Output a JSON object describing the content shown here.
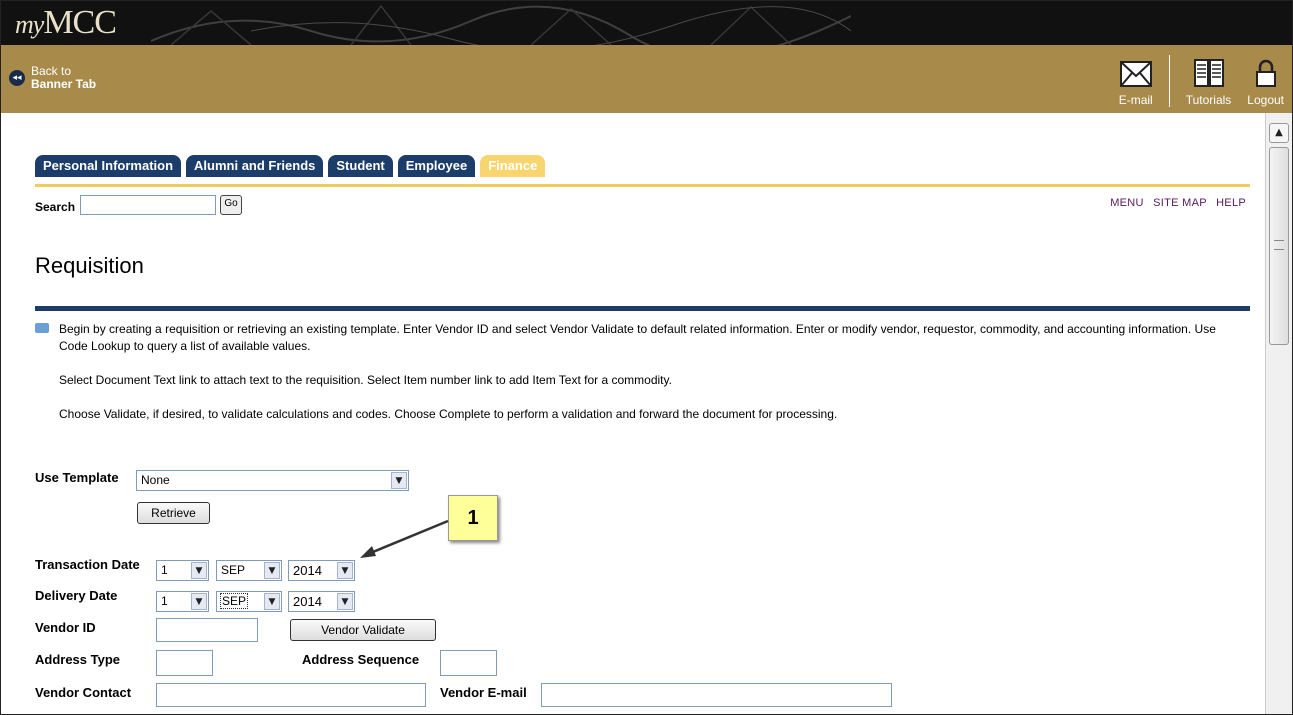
{
  "header": {
    "logo_my": "my",
    "logo_main": "MCC",
    "back_line1": "Back to",
    "back_line2": "Banner Tab",
    "tools": [
      {
        "label": "E-mail",
        "icon": "envelope-icon"
      },
      {
        "label": "Tutorials",
        "icon": "book-icon"
      },
      {
        "label": "Logout",
        "icon": "lock-icon"
      }
    ]
  },
  "tabs": [
    {
      "label": "Personal Information",
      "active": false
    },
    {
      "label": "Alumni and Friends",
      "active": false
    },
    {
      "label": "Student",
      "active": false
    },
    {
      "label": "Employee",
      "active": false
    },
    {
      "label": "Finance",
      "active": true
    }
  ],
  "search": {
    "label": "Search",
    "value": "",
    "go_label": "Go"
  },
  "top_links": {
    "menu": "MENU",
    "site_map": "SITE MAP",
    "help": "HELP"
  },
  "page_title": "Requisition",
  "info": {
    "p1": "Begin by creating a requisition or retrieving an existing template. Enter Vendor ID and select Vendor Validate to default related information. Enter or modify vendor, requestor, commodity, and accounting information. Use Code Lookup to query a list of available values.",
    "p2": "Select Document Text link to attach text to the requisition. Select Item number link to add Item Text for a commodity.",
    "p3": "Choose Validate, if desired, to validate calculations and codes. Choose Complete to perform a validation and forward the document for processing."
  },
  "form": {
    "use_template_label": "Use Template",
    "use_template_value": "None",
    "retrieve_label": "Retrieve",
    "transaction_date_label": "Transaction Date",
    "transaction_day": "1",
    "transaction_month": "SEP",
    "transaction_year": "2014",
    "delivery_date_label": "Delivery Date",
    "delivery_day": "1",
    "delivery_month": "SEP",
    "delivery_year": "2014",
    "vendor_id_label": "Vendor ID",
    "vendor_id_value": "",
    "vendor_validate_label": "Vendor Validate",
    "address_type_label": "Address Type",
    "address_sequence_label": "Address Sequence",
    "vendor_contact_label": "Vendor Contact",
    "vendor_email_label": "Vendor E-mail"
  },
  "callout": {
    "number": "1"
  },
  "colors": {
    "gold": "#a88a4a",
    "navy": "#1c3d6a",
    "finance_tab": "#f8d56e",
    "link_purple": "#5a1a5a"
  }
}
